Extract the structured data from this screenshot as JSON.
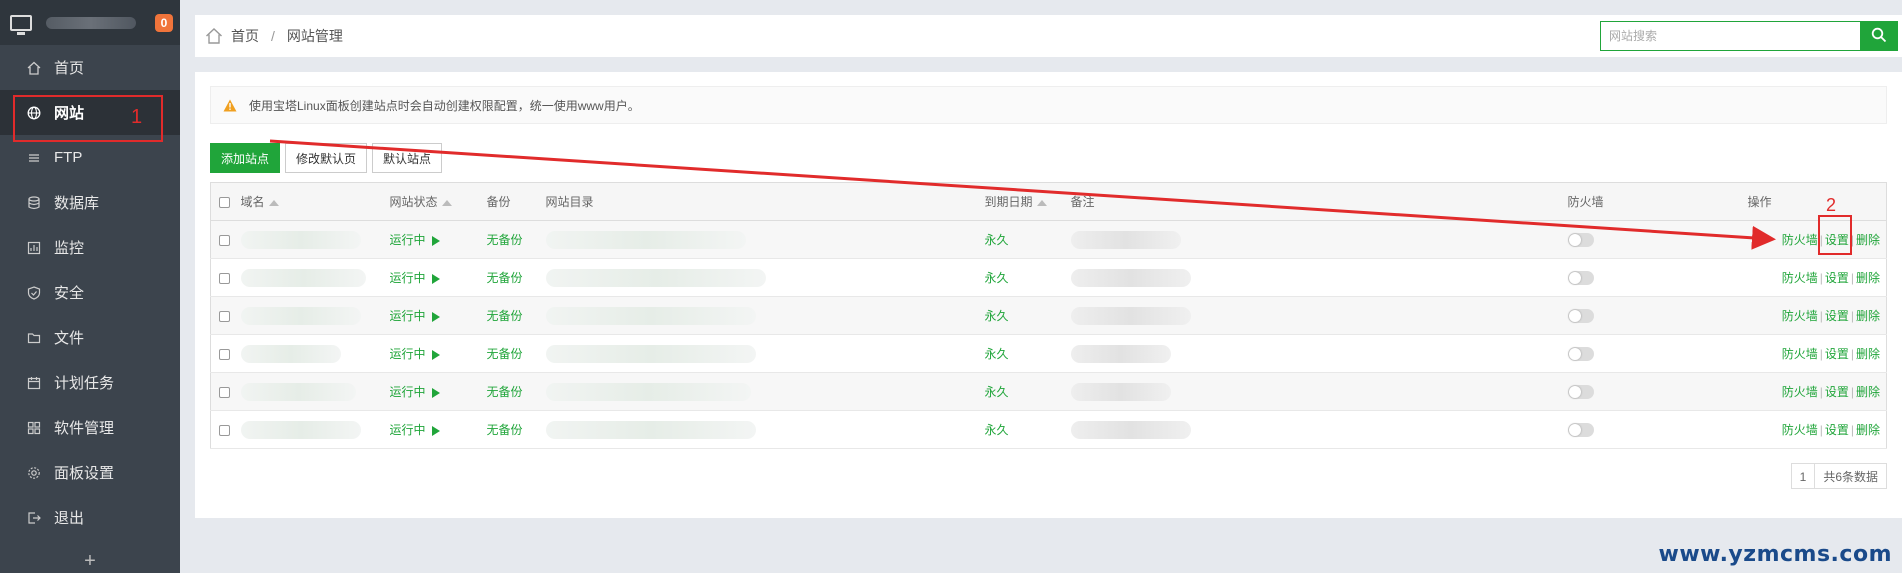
{
  "sidebar": {
    "badge": "0",
    "items": [
      {
        "label": "首页",
        "icon": "home-icon"
      },
      {
        "label": "网站",
        "icon": "globe-icon"
      },
      {
        "label": "FTP",
        "icon": "ftp-icon"
      },
      {
        "label": "数据库",
        "icon": "database-icon"
      },
      {
        "label": "监控",
        "icon": "monitor-chart-icon"
      },
      {
        "label": "安全",
        "icon": "shield-icon"
      },
      {
        "label": "文件",
        "icon": "folder-icon"
      },
      {
        "label": "计划任务",
        "icon": "calendar-icon"
      },
      {
        "label": "软件管理",
        "icon": "grid-icon"
      },
      {
        "label": "面板设置",
        "icon": "gear-icon"
      },
      {
        "label": "退出",
        "icon": "logout-icon"
      }
    ],
    "plus": "+"
  },
  "annotations": {
    "first": "1",
    "second": "2"
  },
  "breadcrumb": {
    "home": "首页",
    "separator": "/",
    "current": "网站管理"
  },
  "search": {
    "placeholder": "网站搜索"
  },
  "tip": {
    "text": "使用宝塔Linux面板创建站点时会自动创建权限配置，统一使用www用户。"
  },
  "buttons": {
    "add": "添加站点",
    "modify_default": "修改默认页",
    "default_site": "默认站点"
  },
  "table": {
    "headers": {
      "domain": "域名",
      "status": "网站状态",
      "backup": "备份",
      "dir": "网站目录",
      "expire": "到期日期",
      "remark": "备注",
      "firewall": "防火墙",
      "ops": "操作"
    },
    "rows": [
      {
        "status": "运行中",
        "backup": "无备份",
        "expire": "永久",
        "op_firewall": "防火墙",
        "op_settings": "设置",
        "op_delete": "删除",
        "sep": "|"
      },
      {
        "status": "运行中",
        "backup": "无备份",
        "expire": "永久",
        "op_firewall": "防火墙",
        "op_settings": "设置",
        "op_delete": "删除",
        "sep": "|"
      },
      {
        "status": "运行中",
        "backup": "无备份",
        "expire": "永久",
        "op_firewall": "防火墙",
        "op_settings": "设置",
        "op_delete": "删除",
        "sep": "|"
      },
      {
        "status": "运行中",
        "backup": "无备份",
        "expire": "永久",
        "op_firewall": "防火墙",
        "op_settings": "设置",
        "op_delete": "删除",
        "sep": "|"
      },
      {
        "status": "运行中",
        "backup": "无备份",
        "expire": "永久",
        "op_firewall": "防火墙",
        "op_settings": "设置",
        "op_delete": "删除",
        "sep": "|"
      },
      {
        "status": "运行中",
        "backup": "无备份",
        "expire": "永久",
        "op_firewall": "防火墙",
        "op_settings": "设置",
        "op_delete": "删除",
        "sep": "|"
      }
    ]
  },
  "pager": {
    "page": "1",
    "total": "共6条数据"
  },
  "watermark": "www.yzmcms.com",
  "colors": {
    "accent": "#20a53a",
    "sidebar": "#3c444d",
    "badge": "#f0743b",
    "annotation": "#e12b2b"
  }
}
